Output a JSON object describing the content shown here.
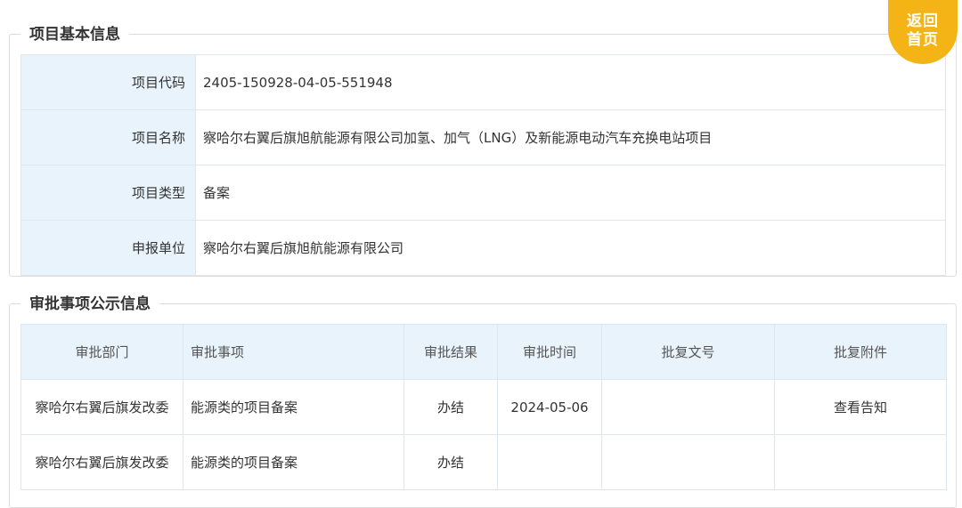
{
  "back_home": {
    "line1": "返回",
    "line2": "首页"
  },
  "basic_info": {
    "title": "项目基本信息",
    "rows": [
      {
        "label": "项目代码",
        "value": "2405-150928-04-05-551948"
      },
      {
        "label": "项目名称",
        "value": "察哈尔右翼后旗旭航能源有限公司加氢、加气（LNG）及新能源电动汽车充换电站项目"
      },
      {
        "label": "项目类型",
        "value": "备案"
      },
      {
        "label": "申报单位",
        "value": "察哈尔右翼后旗旭航能源有限公司"
      }
    ]
  },
  "approval_info": {
    "title": "审批事项公示信息",
    "headers": [
      "审批部门",
      "审批事项",
      "审批结果",
      "审批时间",
      "批复文号",
      "批复附件"
    ],
    "rows": [
      [
        "察哈尔右翼后旗发改委",
        "能源类的项目备案",
        "办结",
        "2024-05-06",
        "",
        "查看告知"
      ],
      [
        "察哈尔右翼后旗发改委",
        "能源类的项目备案",
        "办结",
        "",
        "",
        ""
      ]
    ]
  }
}
